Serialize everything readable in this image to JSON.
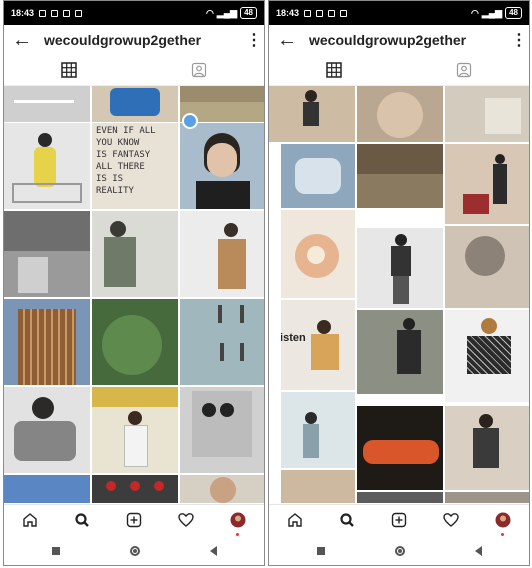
{
  "status_bar": {
    "time": "18:43",
    "battery": "48"
  },
  "header": {
    "username": "wecouldgrowup2gether",
    "back_icon": "arrow-back-icon",
    "menu_icon": "more-vertical-icon"
  },
  "tabs": [
    {
      "icon": "grid-icon",
      "active": true
    },
    {
      "icon": "tagged-icon",
      "active": false
    }
  ],
  "left_grid_text": {
    "poster": "EVEN IF ALL\nYOU KNOW\nIS FANTASY\nALL THERE\nIS IS\nREALITY"
  },
  "right_grid_text": {
    "listen": "listen"
  },
  "bottom_nav": [
    "home-icon",
    "search-icon",
    "add-icon",
    "heart-icon",
    "profile-avatar-icon"
  ],
  "system_nav": [
    "recents-icon",
    "home-circle-icon",
    "back-triangle-icon"
  ],
  "colors": {
    "accent_dot": "#e33333",
    "selection_blue": "#5aa0e6"
  }
}
